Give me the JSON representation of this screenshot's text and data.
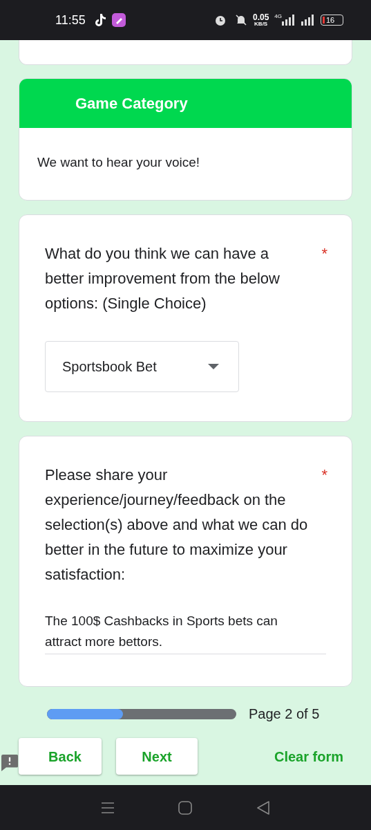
{
  "status_bar": {
    "time": "11:55",
    "speed": "0.05",
    "speed_unit": "KB/S",
    "network": "4G",
    "battery": "16"
  },
  "section": {
    "title": "Game Category",
    "description": "We want to hear your voice!"
  },
  "questions": [
    {
      "kind": "dropdown",
      "text": "What do you think we can have a better improvement from the below options:  (Single Choice)",
      "required_mark": "*",
      "value": "Sportsbook Bet"
    },
    {
      "kind": "paragraph",
      "text": "Please share your experience/journey/feedback on the selection(s) above and what we can do better in the future to maximize your satisfaction:",
      "required_mark": "*",
      "value": "The 100$ Cashbacks in Sports bets can attract more bettors."
    }
  ],
  "progress": {
    "level": 0.4,
    "label": "Page 2 of 5"
  },
  "buttons": {
    "back": "Back",
    "next": "Next",
    "clear": "Clear form"
  }
}
